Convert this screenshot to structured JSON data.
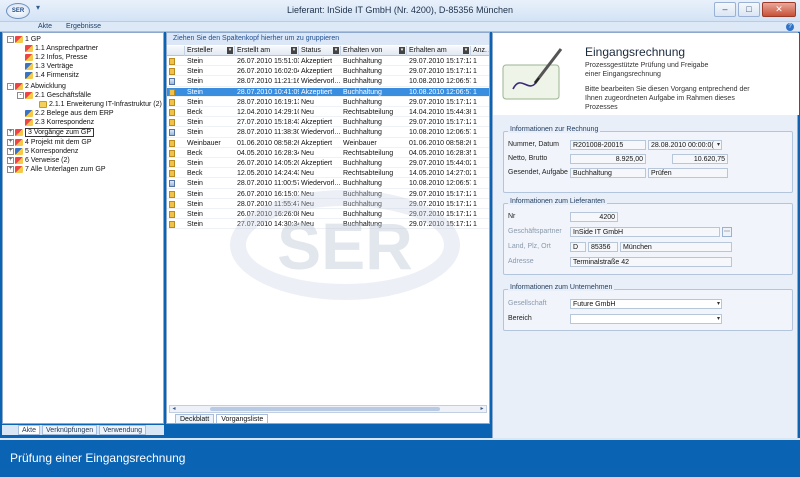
{
  "window": {
    "title": "Lieferant: InSide IT GmbH (Nr. 4200), D-85356 München",
    "logo_text": "SER"
  },
  "ribbon": {
    "tabs": [
      "Akte",
      "Ergebnisse"
    ]
  },
  "tree": {
    "items": [
      {
        "label": "1 GP",
        "toggle": "-"
      },
      {
        "label": "1.1 Ansprechpartner",
        "toggle": ""
      },
      {
        "label": "1.2 Infos, Presse",
        "toggle": ""
      },
      {
        "label": "1.3 Verträge",
        "toggle": ""
      },
      {
        "label": "1.4 Firmensitz",
        "toggle": ""
      },
      {
        "label": "2 Abwicklung",
        "toggle": "-"
      },
      {
        "label": "2.1 Geschäftsfälle",
        "toggle": "-"
      },
      {
        "label": "2.1.1 Erweiterung IT-Infrastruktur (2)",
        "toggle": ""
      },
      {
        "label": "2.2 Belege aus dem ERP",
        "toggle": ""
      },
      {
        "label": "2.3 Korrespondenz",
        "toggle": ""
      },
      {
        "label": "3 Vorgänge zum GP",
        "toggle": "+"
      },
      {
        "label": "4 Projekt mit dem GP",
        "toggle": "+"
      },
      {
        "label": "5 Korrespondenz",
        "toggle": "+"
      },
      {
        "label": "6 Verweise (2)",
        "toggle": "+"
      },
      {
        "label": "7 Alle Unterlagen zum GP",
        "toggle": "+"
      }
    ],
    "bottom_tabs": [
      "Akte",
      "Verknüpfungen",
      "Verwendung"
    ]
  },
  "grid": {
    "group_hint": "Ziehen Sie den Spaltenkopf hierher um zu gruppieren",
    "columns": [
      "Ersteller",
      "Erstellt am",
      "Status",
      "Erhalten von",
      "Erhalten am",
      "Anz. A"
    ],
    "rows": [
      [
        "Stein",
        "26.07.2010 15:51:03",
        "Akzeptiert",
        "Buchhaltung",
        "29.07.2010 15:17:12",
        "1"
      ],
      [
        "Stein",
        "26.07.2010 16:02:04",
        "Akzeptiert",
        "Buchhaltung",
        "29.07.2010 15:17:12",
        "1"
      ],
      [
        "Stein",
        "28.07.2010 11:21:16",
        "Wiedervorl...",
        "Buchhaltung",
        "10.08.2010 12:06:57",
        "1"
      ],
      [
        "Stein",
        "28.07.2010 10:41:09",
        "Akzeptiert",
        "Buchhaltung",
        "10.08.2010 12:06:57",
        "1"
      ],
      [
        "Stein",
        "28.07.2010 16:19:13",
        "Neu",
        "Buchhaltung",
        "29.07.2010 15:17:12",
        "1"
      ],
      [
        "Beck",
        "12.04.2010 14:29:10",
        "Neu",
        "Rechtsabteilung",
        "14.04.2010 15:44:38",
        "1"
      ],
      [
        "Stein",
        "27.07.2010 15:18:43",
        "Akzeptiert",
        "Buchhaltung",
        "29.07.2010 15:17:12",
        "1"
      ],
      [
        "Stein",
        "28.07.2010 11:38:30",
        "Wiedervorl...",
        "Buchhaltung",
        "10.08.2010 12:06:57",
        "1"
      ],
      [
        "Weinbauer",
        "01.06.2010 08:58:26",
        "Akzeptiert",
        "Weinbauer",
        "01.06.2010 08:58:26",
        "1"
      ],
      [
        "Beck",
        "04.05.2010 16:28:34",
        "Neu",
        "Rechtsabteilung",
        "04.05.2010 16:28:35",
        "1"
      ],
      [
        "Stein",
        "26.07.2010 14:05:20",
        "Akzeptiert",
        "Buchhaltung",
        "29.07.2010 15:44:02",
        "1"
      ],
      [
        "Beck",
        "12.05.2010 14:24:43",
        "Neu",
        "Rechtsabteilung",
        "14.05.2010 14:27:02",
        "1"
      ],
      [
        "Stein",
        "28.07.2010 11:00:57",
        "Wiedervorl...",
        "Buchhaltung",
        "10.08.2010 12:06:57",
        "1"
      ],
      [
        "Stein",
        "26.07.2010 16:15:01",
        "Neu",
        "Buchhaltung",
        "29.07.2010 15:17:12",
        "1"
      ],
      [
        "Stein",
        "28.07.2010 11:55:47",
        "Neu",
        "Buchhaltung",
        "29.07.2010 15:17:12",
        "1"
      ],
      [
        "Stein",
        "26.07.2010 16:26:08",
        "Neu",
        "Buchhaltung",
        "29.07.2010 15:17:12",
        "1"
      ],
      [
        "Stein",
        "27.07.2010 14:30:34",
        "Neu",
        "Buchhaltung",
        "29.07.2010 15:17:12",
        "1"
      ]
    ],
    "bottom_tabs": [
      "Deckblatt",
      "Vorgangsliste"
    ]
  },
  "detail": {
    "title": "Eingangsrechnung",
    "subtitle": "Prozessgestützte Prüfung und Freigabe einer Eingangsrechnung",
    "description": "Bitte bearbeiten Sie diesen Vorgang entprechend der Ihnen zugeordneten Aufgabe im Rahmen dieses Prozesses",
    "invoice": {
      "section_title": "Informationen zur Rechnung",
      "nummer_label": "Nummer, Datum",
      "nummer_value": "R201008-20015",
      "datum_value": "28.08.2010 00:00:0(",
      "netto_label": "Netto, Brutto",
      "netto_value": "8.925,00",
      "brutto_value": "10.620,75",
      "gesendet_label": "Gesendet, Aufgabe",
      "gesendet_value": "Buchhaltung",
      "aufgabe_value": "Prüfen"
    },
    "supplier": {
      "section_title": "Informationen zum Lieferanten",
      "nr_label": "Nr",
      "nr_value": "4200",
      "partner_label": "Geschäftspartner",
      "partner_value": "InSide IT GmbH",
      "land_label": "Land, Plz, Ort",
      "land_value": "D",
      "plz_value": "85356",
      "ort_value": "München",
      "adresse_label": "Adresse",
      "adresse_value": "Terminalstraße 42"
    },
    "company": {
      "section_title": "Informationen zum Unternehmen",
      "gesellschaft_label": "Gesellschaft",
      "gesellschaft_value": "Future GmbH",
      "bereich_label": "Bereich",
      "bereich_value": ""
    }
  },
  "caption": "Prüfung einer Eingangsrechnung",
  "watermark_text": "SER"
}
